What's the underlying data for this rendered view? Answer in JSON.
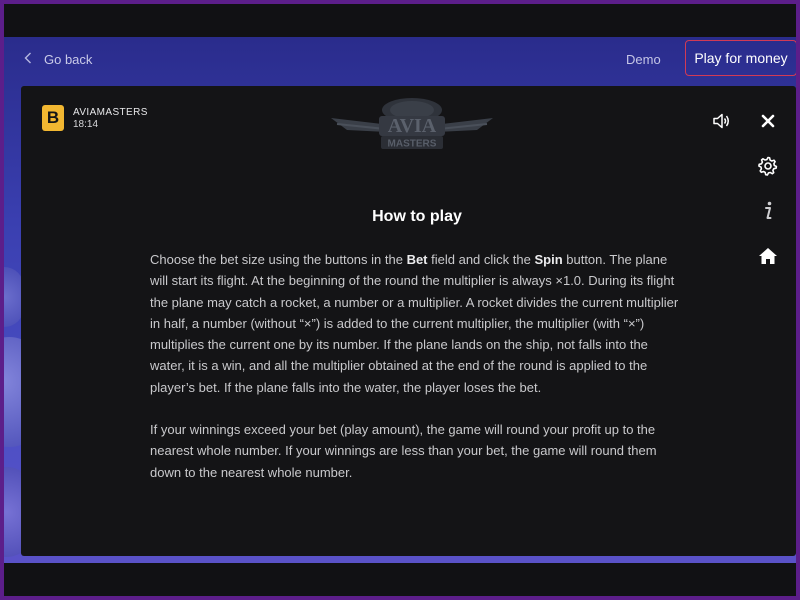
{
  "nav": {
    "back_label": "Go back",
    "demo_label": "Demo",
    "play_money_label": "Play for money"
  },
  "brand": {
    "logo_letter": "B",
    "name": "AVIAMASTERS",
    "time": "18:14"
  },
  "game_logo": {
    "line1": "AVIA",
    "line2": "MASTERS"
  },
  "icons": [
    "speaker-icon",
    "close-icon",
    "gear-icon",
    "info-icon",
    "home-icon",
    "chevron-left-icon"
  ],
  "colors": {
    "accent": "#d23a55",
    "brand_yellow": "#f2b731",
    "modal_bg": "#141416",
    "purple_border": "#5c1e8a"
  },
  "help": {
    "title": "How to play",
    "p1_part1": "Choose the bet size using the buttons in the ",
    "p1_bold1": "Bet",
    "p1_part2": " field and click the ",
    "p1_bold2": "Spin",
    "p1_part3": " button. The plane will start its flight. At the beginning of the round the multiplier is always ×1.0. During its flight the plane may catch a rocket, a number or a multiplier. A rocket divides the current multiplier in half, a number (without “×”) is added to the current multiplier, the multiplier (with “×”) multiplies the current one by its number. If the plane lands on the ship, not falls into the water, it is a win, and all the multiplier obtained at the end of the round is applied to the player’s bet. If the plane falls into the water, the player loses the bet.",
    "p2": "If your winnings exceed your bet (play amount), the game will round your profit up to the nearest whole number. If your winnings are less than your bet, the game will round them down to the nearest whole number."
  }
}
